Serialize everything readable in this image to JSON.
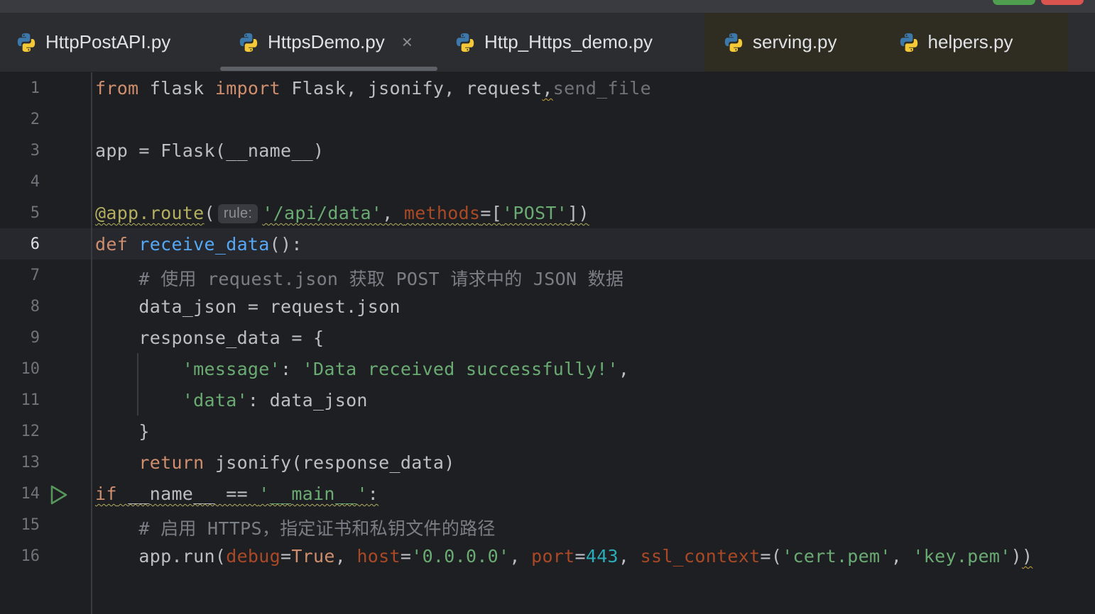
{
  "tabs": [
    {
      "label": "HttpPostAPI.py",
      "active": false
    },
    {
      "label": "HttpsDemo.py",
      "active": true,
      "close": "×"
    },
    {
      "label": "Http_Https_demo.py",
      "active": false
    },
    {
      "label": "serving.py",
      "active": false
    },
    {
      "label": "helpers.py",
      "active": false
    }
  ],
  "editor": {
    "active_line": 6,
    "inlay_hint": "rule:",
    "line_numbers": [
      "1",
      "2",
      "3",
      "4",
      "5",
      "6",
      "7",
      "8",
      "9",
      "10",
      "11",
      "12",
      "13",
      "14",
      "15",
      "16"
    ]
  },
  "colors": {
    "background": "#1e1f22",
    "keyword": "#cf8e6d",
    "function": "#56a8f5",
    "string": "#6aab73",
    "comment": "#7a7e85",
    "decorator": "#b3ae60",
    "number": "#2aacb8"
  },
  "icons": {
    "file": "python-file-icon",
    "run": "run-gutter-icon"
  }
}
